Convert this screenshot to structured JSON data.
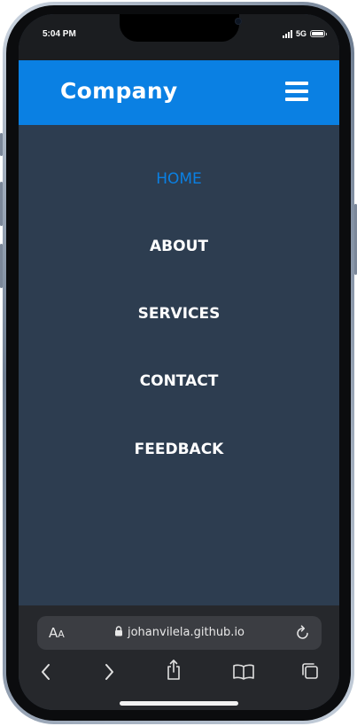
{
  "status_bar": {
    "time": "5:04 PM",
    "network": "5G"
  },
  "site": {
    "brand": "Company",
    "menu_icon": "hamburger-menu-icon",
    "accent_color": "#0a80e3",
    "header_color": "#0a80e3",
    "menu_background": "#2d3d50",
    "nav": [
      {
        "label": "HOME",
        "active": true
      },
      {
        "label": "ABOUT",
        "active": false
      },
      {
        "label": "SERVICES",
        "active": false
      },
      {
        "label": "CONTACT",
        "active": false
      },
      {
        "label": "FEEDBACK",
        "active": false
      }
    ]
  },
  "browser": {
    "text_size_label_big": "A",
    "text_size_label_small": "A",
    "url": "johanvilela.github.io",
    "toolbar_icons": [
      "back-icon",
      "forward-icon",
      "share-icon",
      "bookmarks-icon",
      "tabs-icon"
    ]
  }
}
